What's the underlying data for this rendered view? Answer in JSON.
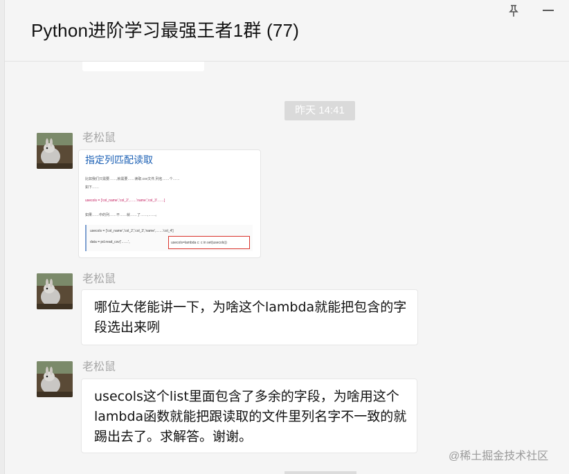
{
  "window": {
    "title": "Python进阶学习最强王者1群 (77)",
    "icons": [
      "pin-icon",
      "minimize-icon"
    ]
  },
  "chat": {
    "timestamp": "昨天 14:41",
    "messages": [
      {
        "sender": "老松鼠",
        "type": "image",
        "image": {
          "heading": "指定列匹配读取",
          "lines": [
            "比如我们只需要……,就需要……读取.csv文件,列名……个……",
            "如下……",
            "usecols = ['col_name','col_2',……'name','col_3'……]",
            "如果……中的列……不……就……了……,……。"
          ],
          "code_lines": [
            "usecols = ['col_name','col_2','col_3','name',……'col_4']",
            "data = pd.read_csv('……',"
          ],
          "highlight": "usecols=lambda c: c in set(usecols))"
        }
      },
      {
        "sender": "老松鼠",
        "type": "text",
        "text": "哪位大佬能讲一下，为啥这个lambda就能把包含的字段选出来咧"
      },
      {
        "sender": "老松鼠",
        "type": "text",
        "text": "usecols这个list里面包含了多余的字段，为啥用这个lambda函数就能把跟读取的文件里列名字不一致的就踢出去了。求解答。谢谢。"
      }
    ]
  },
  "watermark": "@稀土掘金技术社区",
  "colors": {
    "background": "#f5f5f5",
    "bubble": "#ffffff",
    "timestamp_bg": "#dadada",
    "sender": "#a7a7a7",
    "highlight_border": "#d9322b"
  }
}
